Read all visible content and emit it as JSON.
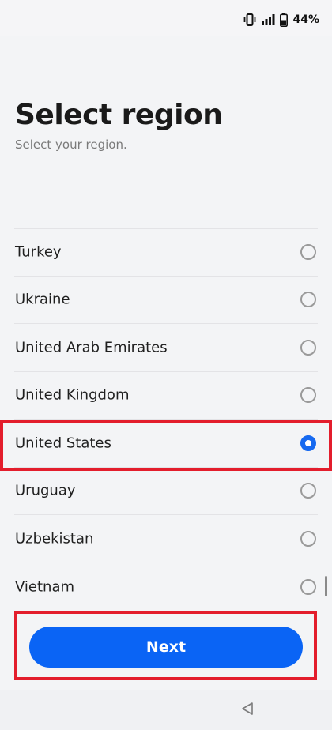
{
  "status_bar": {
    "battery_text": "44%",
    "icons": [
      "vibrate-icon",
      "signal-icon",
      "battery-icon"
    ]
  },
  "header": {
    "title": "Select region",
    "subtitle": "Select your region."
  },
  "regions": {
    "items": [
      {
        "label": "Turkey",
        "selected": false
      },
      {
        "label": "Ukraine",
        "selected": false
      },
      {
        "label": "United Arab Emirates",
        "selected": false
      },
      {
        "label": "United Kingdom",
        "selected": false
      },
      {
        "label": "United States",
        "selected": true
      },
      {
        "label": "Uruguay",
        "selected": false
      },
      {
        "label": "Uzbekistan",
        "selected": false
      },
      {
        "label": "Vietnam",
        "selected": false
      }
    ]
  },
  "actions": {
    "next_label": "Next"
  },
  "nav_bar": {
    "icons": [
      "back-triangle-icon"
    ]
  },
  "colors": {
    "accent": "#0a64f5",
    "highlight": "#e31d2c",
    "background": "#f3f4f6"
  }
}
